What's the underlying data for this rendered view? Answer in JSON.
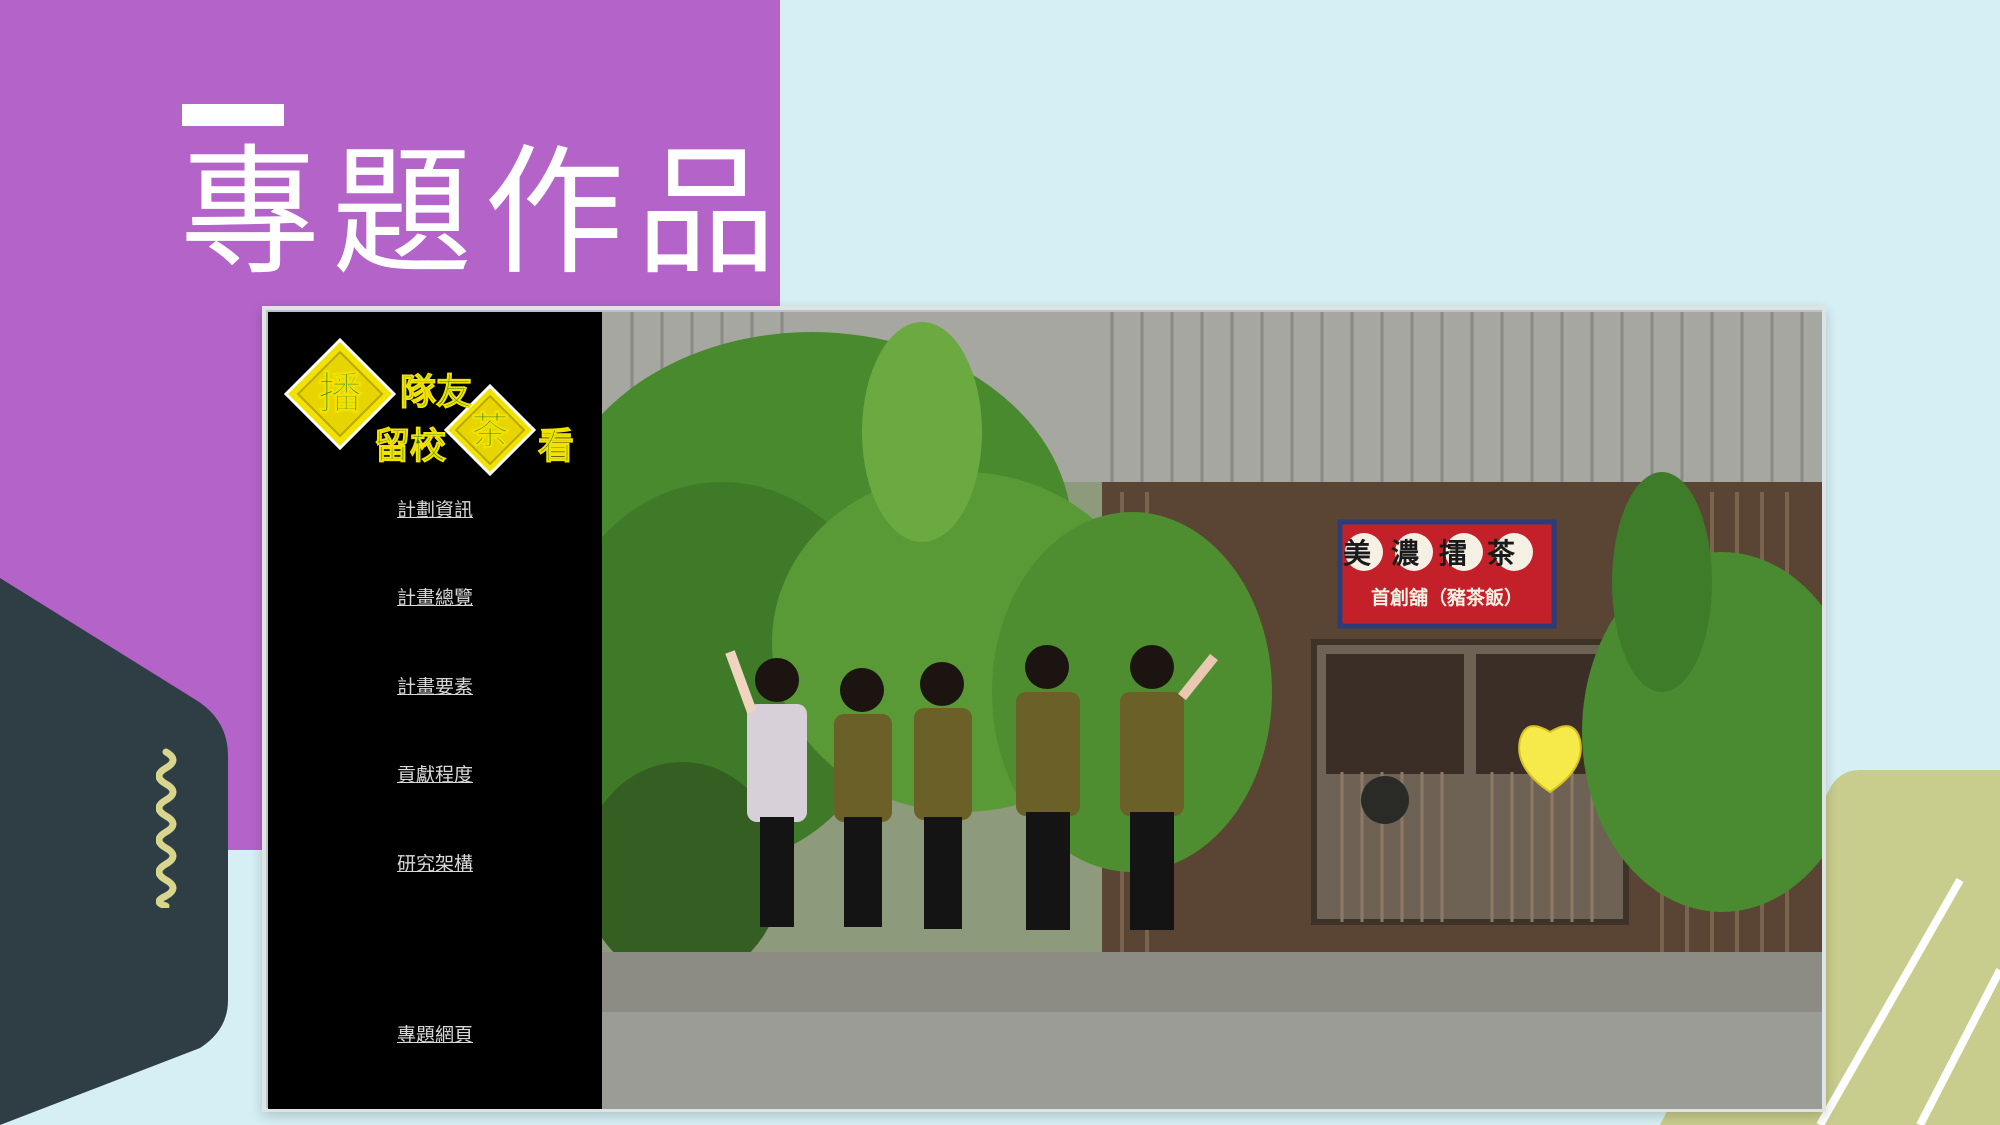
{
  "slide": {
    "title": "專題作品",
    "colors": {
      "purple": "#b464c8",
      "light_blue": "#d5eff4",
      "dark_slate": "#2f3e45",
      "olive": "#c8cc8c"
    }
  },
  "website": {
    "logo": {
      "chars": [
        "播",
        "隊友",
        "留校",
        "茶",
        "看"
      ],
      "colors": {
        "diamond": "#f2e200",
        "text": "#1f7a2c"
      }
    },
    "nav": [
      {
        "label": "計劃資訊"
      },
      {
        "label": "計畫總覽"
      },
      {
        "label": "計畫要素"
      },
      {
        "label": "貢獻程度"
      },
      {
        "label": "研究架構"
      },
      {
        "label": "專題網頁"
      }
    ],
    "photo": {
      "sign_main": "美濃擂茶",
      "sign_sub": "首創舖（豬茶飯）"
    }
  }
}
